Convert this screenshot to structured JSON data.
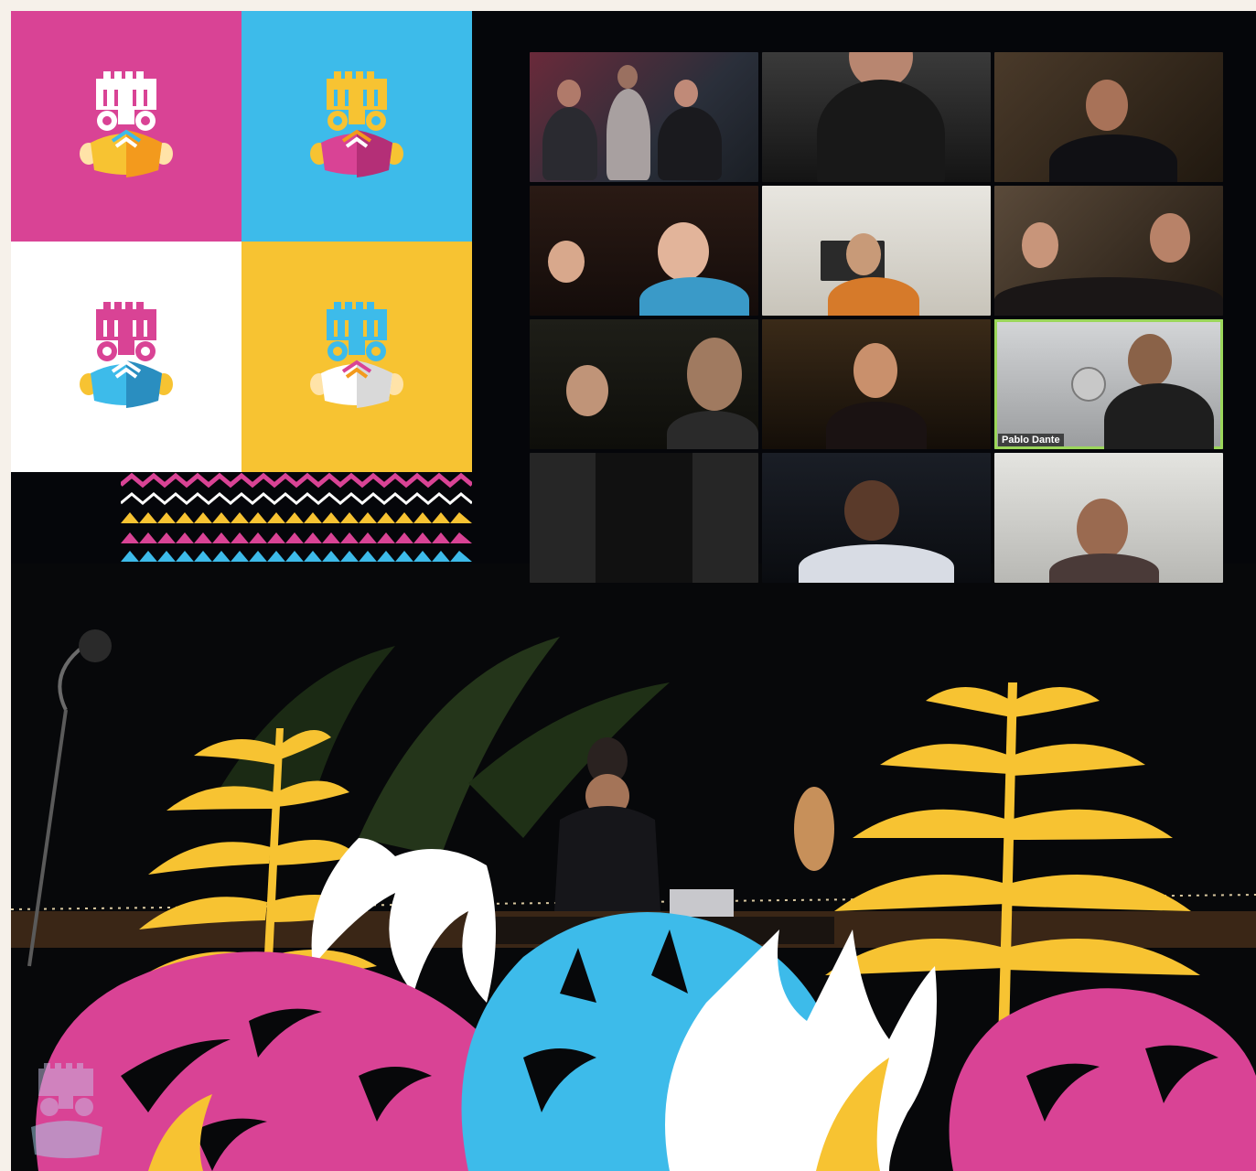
{
  "brand_colors": {
    "pink": "#d94395",
    "blue": "#3dbbea",
    "yellow": "#f7c332",
    "white": "#ffffff",
    "orange": "#f39a1d"
  },
  "logo_tiles": [
    {
      "bg": "#d94395",
      "crown": "#ffffff",
      "mask": "#f7c332",
      "mask_dark": "#f39a1d",
      "ear": "#ffe3a8"
    },
    {
      "bg": "#3dbbea",
      "crown": "#f7c332",
      "mask": "#d94395",
      "mask_dark": "#b42f77",
      "ear": "#f7c332"
    },
    {
      "bg": "#ffffff",
      "crown": "#d94395",
      "mask": "#3dbbea",
      "mask_dark": "#2a8ec0",
      "ear": "#f7c332"
    },
    {
      "bg": "#f7c332",
      "crown": "#3dbbea",
      "mask": "#ffffff",
      "mask_dark": "#d9d9d9",
      "ear": "#ffe3a8"
    }
  ],
  "video_call": {
    "active_speaker_name": "Pablo Dante",
    "participant_count": 12
  }
}
